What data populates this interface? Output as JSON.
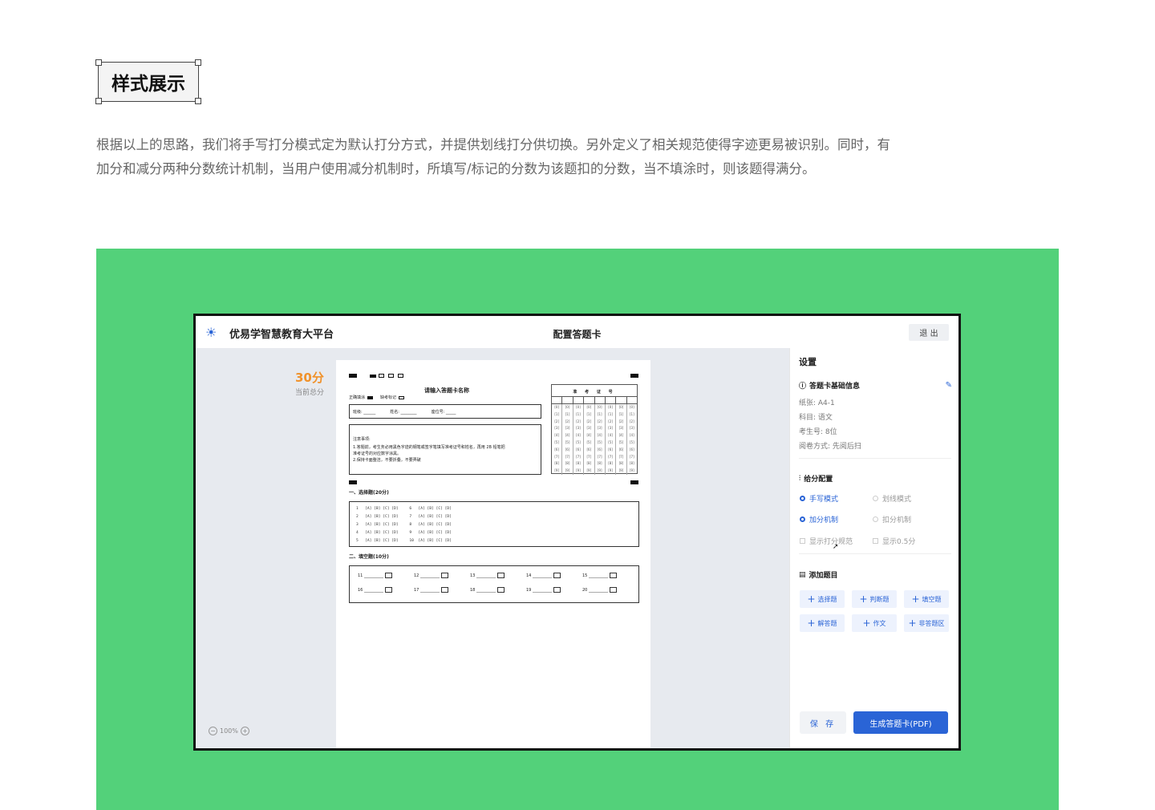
{
  "heading": "样式展示",
  "description": [
    "根据以上的思路，我们将手写打分模式定为默认打分方式，并提供划线打分供切换。另外定义了相关规范使得字迹更易被识别。同时，有",
    "加分和减分两种分数统计机制，当用户使用减分机制时，所填写/标记的分数为该题扣的分数，当不填涂时，则该题得满分。"
  ],
  "app": {
    "brand": "优易学智慧教育大平台",
    "title": "配置答题卡",
    "exit": "退 出",
    "score": "30分",
    "score_label": "当前总分",
    "zoom": "100%",
    "colors": {
      "accent": "#2a64d6",
      "score": "#f0922b",
      "stage": "#53d17a"
    }
  },
  "sheet": {
    "title": "请输入答题卡名称",
    "legend_filled": "正确填涂",
    "legend_missing": "缺考标记",
    "info_fields": [
      "班级: ______",
      "姓名: ________",
      "座位号: _____"
    ],
    "notes_title": "注意事项:",
    "notes": [
      "1.答题前，考生务必用黑色字迹的钢笔或签字笔填写准考证号和姓名，再用 2B 铅笔把",
      "准考证号的对应数字涂黑。",
      "2.保持卡面整洁，不要折叠，不要弄破"
    ],
    "id_title": "准 考 证 号",
    "id_digits": [
      "[0]",
      "[1]",
      "[2]",
      "[3]",
      "[4]",
      "[5]",
      "[6]",
      "[7]",
      "[8]",
      "[9]"
    ],
    "section1": "一、选择题(20分)",
    "choices": [
      "1   [A] [B] [C] [D]     6   [A] [B] [C] [D]",
      "2   [A] [B] [C] [D]     7   [A] [B] [C] [D]",
      "3   [A] [B] [C] [D]     8   [A] [B] [C] [D]",
      "4   [A] [B] [C] [D]     9   [A] [B] [C] [D]",
      "5   [A] [B] [C] [D]     10  [A] [B] [C] [D]"
    ],
    "section2": "二、填空题(10分)",
    "blanks": [
      "11",
      "12",
      "13",
      "14",
      "15",
      "16",
      "17",
      "18",
      "19",
      "20"
    ]
  },
  "panel": {
    "title": "设置",
    "basic_info": "答题卡基础信息",
    "paper": "纸张: A4-1",
    "subject": "科目: 语文",
    "exam_no": "考生号: 8位",
    "scan": "阅卷方式: 先阅后扫",
    "score_config": "给分配置",
    "mode_handwrite": "手写模式",
    "mode_line": "划线模式",
    "mech_add": "加分机制",
    "mech_deduct": "扣分机制",
    "show_rule": "显示打分规范",
    "show_half": "显示0.5分",
    "add_question": "添加题目",
    "buttons": [
      "选择题",
      "判断题",
      "填空题",
      "解答题",
      "作文",
      "非答题区"
    ],
    "save": "保 存",
    "generate": "生成答题卡(PDF)"
  }
}
